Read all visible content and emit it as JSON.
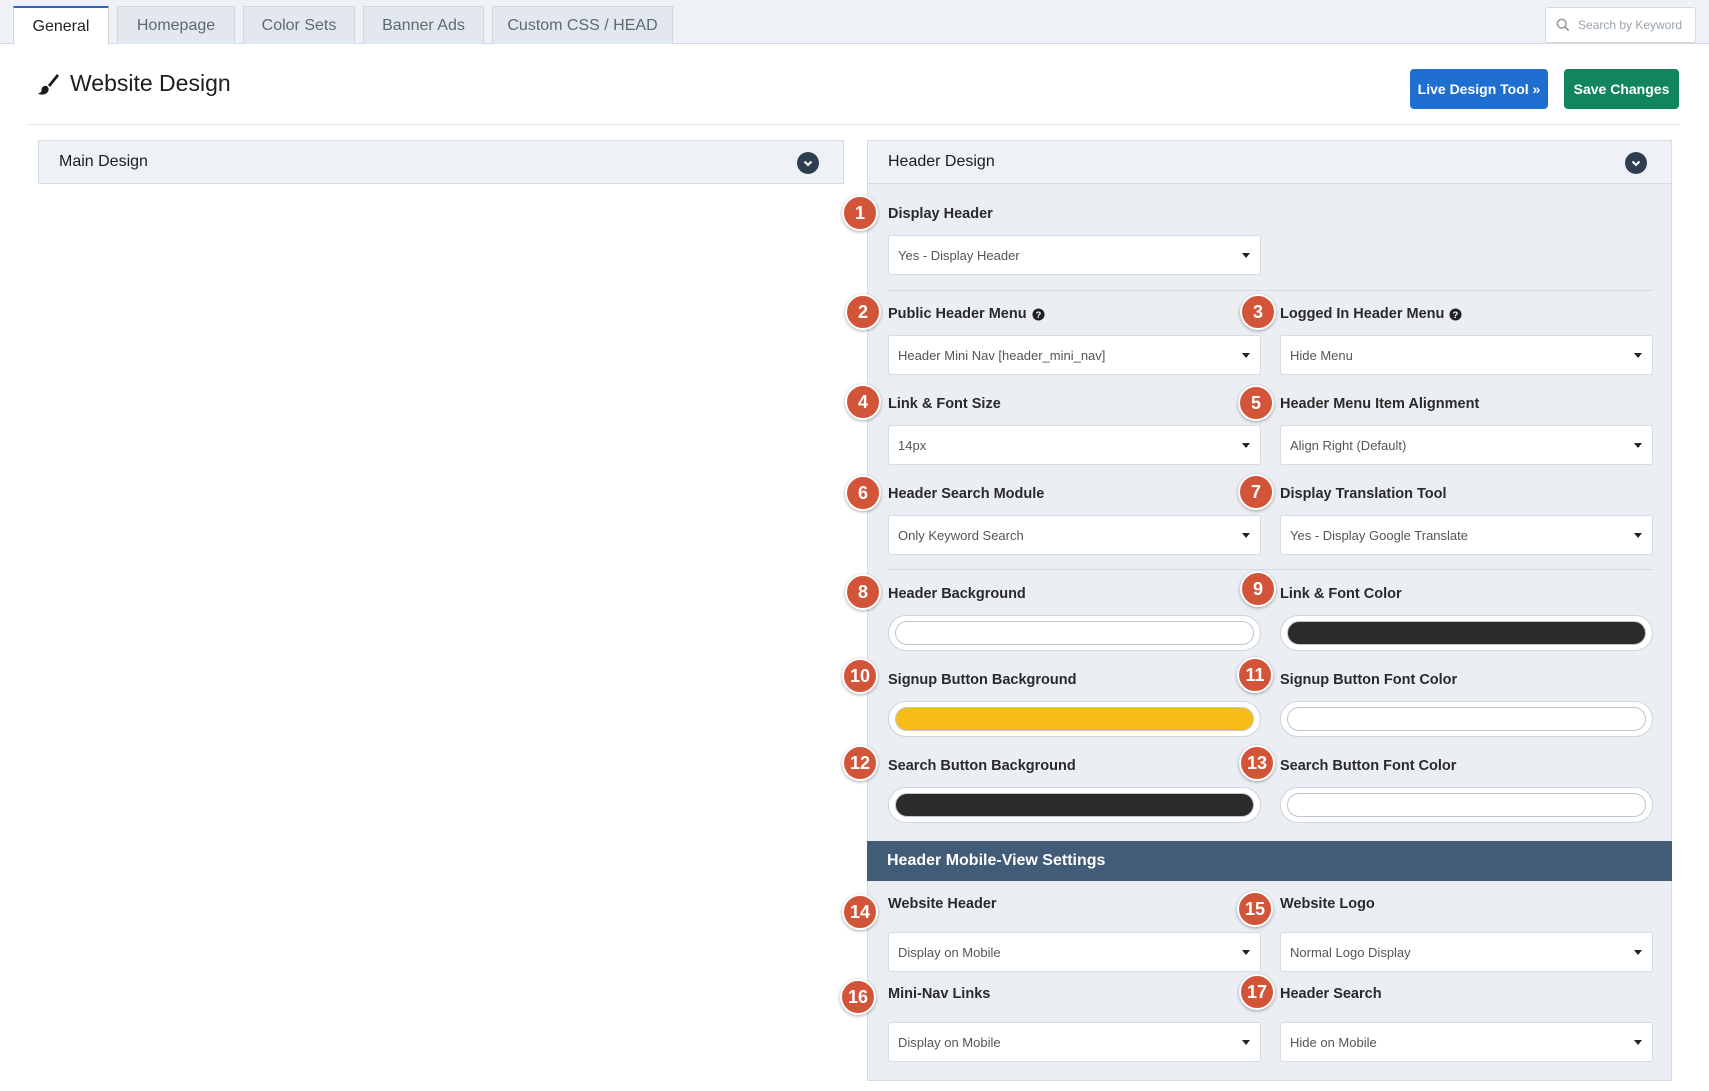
{
  "tabs": [
    {
      "label": "General",
      "active": true
    },
    {
      "label": "Homepage"
    },
    {
      "label": "Color Sets"
    },
    {
      "label": "Banner Ads"
    },
    {
      "label": "Custom CSS / HEAD"
    }
  ],
  "search": {
    "placeholder": "Search by Keyword",
    "icon": "search-icon"
  },
  "page": {
    "title": "Website Design",
    "icon": "paintbrush-icon"
  },
  "buttons": {
    "live_design": "Live Design Tool »",
    "save": "Save Changes"
  },
  "colors": {
    "blue_button": "#1f6fd1",
    "green_button": "#12845f",
    "badge": "#d2553a",
    "subheader": "#425b76"
  },
  "panels": {
    "main_design": "Main Design",
    "header_design": "Header Design"
  },
  "fields": {
    "display_header": {
      "badge": "1",
      "label": "Display Header",
      "value": "Yes - Display Header"
    },
    "public_header_menu": {
      "badge": "2",
      "label": "Public Header Menu",
      "value": "Header Mini Nav [header_mini_nav]"
    },
    "logged_in_header_menu": {
      "badge": "3",
      "label": "Logged In Header Menu",
      "value": "Hide Menu"
    },
    "link_font_size": {
      "badge": "4",
      "label": "Link & Font Size",
      "value": "14px"
    },
    "header_menu_alignment": {
      "badge": "5",
      "label": "Header Menu Item Alignment",
      "value": "Align Right (Default)"
    },
    "header_search_module": {
      "badge": "6",
      "label": "Header Search Module",
      "value": "Only Keyword Search"
    },
    "display_translation_tool": {
      "badge": "7",
      "label": "Display Translation Tool",
      "value": "Yes - Display Google Translate"
    },
    "header_background": {
      "badge": "8",
      "label": "Header Background",
      "color": "#ffffff"
    },
    "link_font_color": {
      "badge": "9",
      "label": "Link & Font Color",
      "color": "#2b2b2b"
    },
    "signup_button_background": {
      "badge": "10",
      "label": "Signup Button Background",
      "color": "#f7bd16"
    },
    "signup_button_font_color": {
      "badge": "11",
      "label": "Signup Button Font Color",
      "color": "#ffffff"
    },
    "search_button_background": {
      "badge": "12",
      "label": "Search Button Background",
      "color": "#2b2b2b"
    },
    "search_button_font_color": {
      "badge": "13",
      "label": "Search Button Font Color",
      "color": "#ffffff"
    }
  },
  "mobile": {
    "title": "Header Mobile-View Settings",
    "website_header": {
      "badge": "14",
      "label": "Website Header",
      "value": "Display on Mobile"
    },
    "website_logo": {
      "badge": "15",
      "label": "Website Logo",
      "value": "Normal Logo Display"
    },
    "mini_nav_links": {
      "badge": "16",
      "label": "Mini-Nav Links",
      "value": "Display on Mobile"
    },
    "header_search": {
      "badge": "17",
      "label": "Header Search",
      "value": "Hide on Mobile"
    }
  }
}
